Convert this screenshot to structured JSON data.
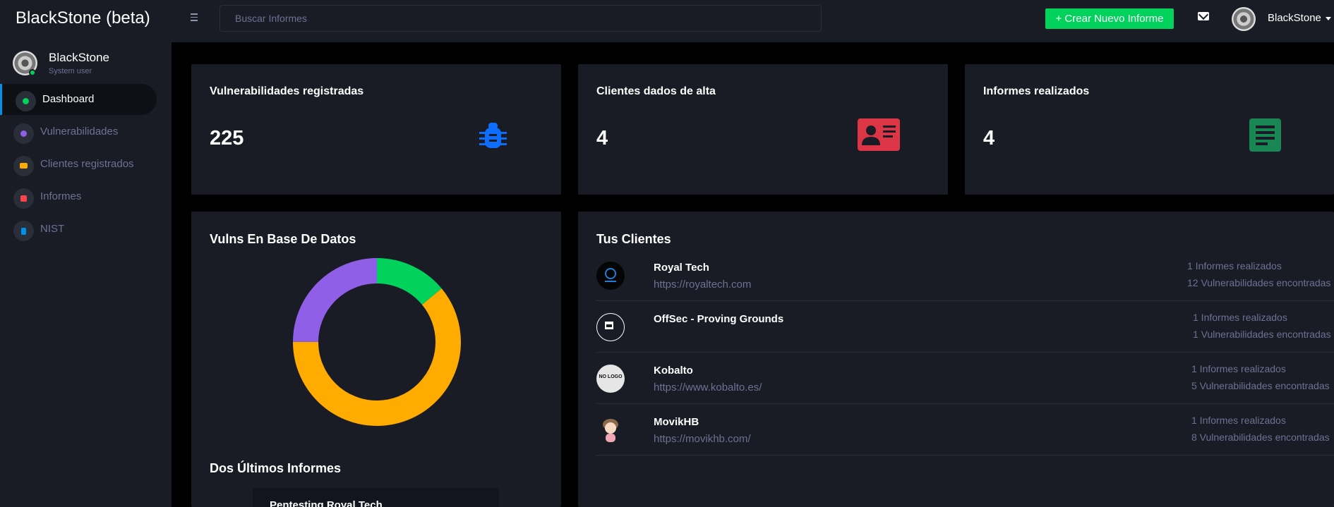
{
  "app": {
    "brand": "BlackStone (beta)"
  },
  "topbar": {
    "search_placeholder": "Buscar Informes",
    "create_button": "+ Crear Nuevo Informe",
    "username": "BlackStone"
  },
  "sidebar": {
    "profile_name": "BlackStone",
    "profile_role": "System user",
    "items": [
      {
        "label": "Dashboard",
        "icon": "speedometer-icon",
        "color": "#00d25b"
      },
      {
        "label": "Vulnerabilidades",
        "icon": "bug-icon",
        "color": "#8f5fe8"
      },
      {
        "label": "Clientes registrados",
        "icon": "contacts-icon",
        "color": "#ffab00"
      },
      {
        "label": "Informes",
        "icon": "file-document-icon",
        "color": "#fc424a"
      },
      {
        "label": "NIST",
        "icon": "calculator-icon",
        "color": "#0090e7"
      }
    ]
  },
  "stats": [
    {
      "title": "Vulnerabilidades registradas",
      "value": "225",
      "icon": "bug-icon",
      "color": "#0d6efd"
    },
    {
      "title": "Clientes dados de alta",
      "value": "4",
      "icon": "id-card-icon",
      "color": "#dc3545"
    },
    {
      "title": "Informes realizados",
      "value": "4",
      "icon": "document-icon",
      "color": "#198754"
    }
  ],
  "vulns_section": {
    "title": "Vulns En Base De Datos"
  },
  "chart_data": {
    "type": "pie",
    "segments": [
      {
        "value": 14,
        "color": "#00d25b"
      },
      {
        "value": 61,
        "color": "#ffab00"
      },
      {
        "value": 25,
        "color": "#8f5fe8"
      }
    ]
  },
  "reports_section": {
    "title": "Dos Últimos Informes",
    "items": [
      {
        "title": "Pentesting Royal Tech"
      }
    ]
  },
  "clients_section": {
    "title": "Tus Clientes",
    "clients": [
      {
        "name": "Royal Tech",
        "url": "https://royaltech.com",
        "reports": "1 Informes realizados",
        "vulns": "12 Vulnerabilidades encontradas",
        "logo": "royal-tech-logo"
      },
      {
        "name": "OffSec - Proving Grounds",
        "url": "",
        "reports": "1 Informes realizados",
        "vulns": "1 Vulnerabilidades encontradas",
        "logo": "broken-image-icon"
      },
      {
        "name": "Kobalto",
        "url": "https://www.kobalto.es/",
        "reports": "1 Informes realizados",
        "vulns": "5 Vulnerabilidades encontradas",
        "logo": "no-logo",
        "logo_text": "NO LOGO"
      },
      {
        "name": "MovikHB",
        "url": "https://movikhb.com/",
        "reports": "1 Informes realizados",
        "vulns": "8 Vulnerabilidades encontradas",
        "logo": "cartoon-avatar-logo"
      }
    ]
  }
}
